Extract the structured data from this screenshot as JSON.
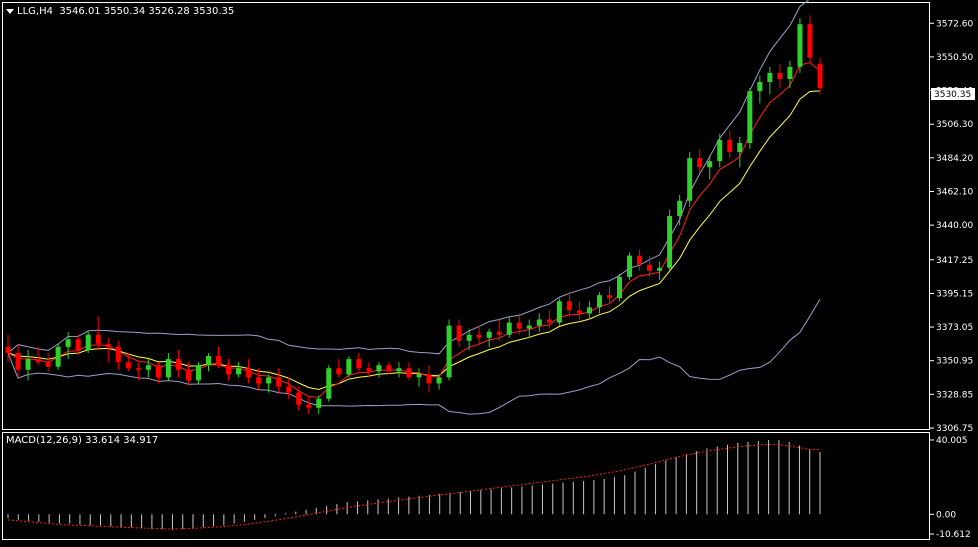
{
  "header": {
    "symbol_tf": "LLG,H4",
    "ohlc": "3546.01 3550.34 3526.28 3530.35"
  },
  "macd_header": "MACD(12,26,9) 33.614 34.917",
  "current_price": "3530.35",
  "colors": {
    "background": "#000000",
    "bull": "#2fd12f",
    "bear": "#ff0000",
    "ma_fast": "#ff2020",
    "ma_slow": "#ffff40",
    "bands": "#9aa0c8",
    "macd_hist": "#c8c8c8",
    "macd_signal": "#ff2020",
    "frame": "#ffffff"
  },
  "chart_data": [
    {
      "type": "candlestick",
      "title": "LLG,H4",
      "y_ticks": [
        "3572.60",
        "3550.50",
        "3528.40",
        "3506.30",
        "3484.20",
        "3462.10",
        "3440.00",
        "3417.25",
        "3395.15",
        "3373.05",
        "3350.95",
        "3328.85",
        "3306.75"
      ],
      "ylim": [
        3306.75,
        3580
      ],
      "candles": [
        [
          3360,
          3368,
          3350,
          3356
        ],
        [
          3356,
          3362,
          3340,
          3345
        ],
        [
          3345,
          3358,
          3338,
          3352
        ],
        [
          3352,
          3360,
          3348,
          3350
        ],
        [
          3350,
          3356,
          3344,
          3347
        ],
        [
          3347,
          3362,
          3345,
          3360
        ],
        [
          3360,
          3370,
          3352,
          3365
        ],
        [
          3365,
          3368,
          3355,
          3358
        ],
        [
          3358,
          3370,
          3356,
          3368
        ],
        [
          3368,
          3380,
          3358,
          3362
        ],
        [
          3362,
          3366,
          3350,
          3360
        ],
        [
          3360,
          3364,
          3345,
          3350
        ],
        [
          3350,
          3356,
          3344,
          3346
        ],
        [
          3346,
          3350,
          3338,
          3345
        ],
        [
          3345,
          3352,
          3340,
          3348
        ],
        [
          3348,
          3350,
          3336,
          3340
        ],
        [
          3340,
          3356,
          3338,
          3352
        ],
        [
          3352,
          3358,
          3340,
          3345
        ],
        [
          3345,
          3350,
          3335,
          3338
        ],
        [
          3338,
          3350,
          3336,
          3348
        ],
        [
          3348,
          3356,
          3344,
          3354
        ],
        [
          3354,
          3360,
          3346,
          3348
        ],
        [
          3348,
          3352,
          3338,
          3342
        ],
        [
          3342,
          3350,
          3340,
          3346
        ],
        [
          3346,
          3352,
          3336,
          3340
        ],
        [
          3340,
          3346,
          3332,
          3336
        ],
        [
          3336,
          3342,
          3330,
          3340
        ],
        [
          3340,
          3346,
          3330,
          3334
        ],
        [
          3334,
          3340,
          3326,
          3330
        ],
        [
          3330,
          3334,
          3318,
          3322
        ],
        [
          3322,
          3328,
          3316,
          3320
        ],
        [
          3320,
          3328,
          3316,
          3326
        ],
        [
          3326,
          3348,
          3324,
          3346
        ],
        [
          3346,
          3352,
          3340,
          3342
        ],
        [
          3342,
          3354,
          3340,
          3352
        ],
        [
          3352,
          3356,
          3344,
          3346
        ],
        [
          3346,
          3350,
          3340,
          3344
        ],
        [
          3344,
          3350,
          3340,
          3348
        ],
        [
          3348,
          3350,
          3342,
          3344
        ],
        [
          3344,
          3350,
          3340,
          3346
        ],
        [
          3346,
          3350,
          3338,
          3340
        ],
        [
          3340,
          3346,
          3334,
          3342
        ],
        [
          3342,
          3348,
          3330,
          3336
        ],
        [
          3336,
          3342,
          3332,
          3340
        ],
        [
          3340,
          3378,
          3338,
          3374
        ],
        [
          3374,
          3378,
          3360,
          3364
        ],
        [
          3364,
          3372,
          3358,
          3368
        ],
        [
          3368,
          3374,
          3362,
          3366
        ],
        [
          3366,
          3372,
          3360,
          3370
        ],
        [
          3370,
          3378,
          3364,
          3368
        ],
        [
          3368,
          3380,
          3366,
          3376
        ],
        [
          3376,
          3382,
          3368,
          3372
        ],
        [
          3372,
          3378,
          3366,
          3374
        ],
        [
          3374,
          3382,
          3370,
          3378
        ],
        [
          3378,
          3384,
          3372,
          3376
        ],
        [
          3376,
          3392,
          3374,
          3390
        ],
        [
          3390,
          3396,
          3380,
          3384
        ],
        [
          3384,
          3390,
          3378,
          3382
        ],
        [
          3382,
          3390,
          3378,
          3386
        ],
        [
          3386,
          3396,
          3382,
          3394
        ],
        [
          3394,
          3400,
          3388,
          3392
        ],
        [
          3392,
          3408,
          3390,
          3406
        ],
        [
          3406,
          3422,
          3404,
          3420
        ],
        [
          3420,
          3424,
          3410,
          3414
        ],
        [
          3414,
          3420,
          3406,
          3410
        ],
        [
          3410,
          3416,
          3404,
          3412
        ],
        [
          3412,
          3450,
          3410,
          3446
        ],
        [
          3446,
          3460,
          3440,
          3456
        ],
        [
          3456,
          3488,
          3452,
          3484
        ],
        [
          3484,
          3490,
          3474,
          3478
        ],
        [
          3478,
          3486,
          3470,
          3482
        ],
        [
          3482,
          3500,
          3478,
          3496
        ],
        [
          3496,
          3502,
          3484,
          3488
        ],
        [
          3488,
          3498,
          3478,
          3494
        ],
        [
          3494,
          3530,
          3490,
          3528
        ],
        [
          3528,
          3538,
          3520,
          3534
        ],
        [
          3534,
          3544,
          3526,
          3540
        ],
        [
          3540,
          3546,
          3530,
          3536
        ],
        [
          3536,
          3548,
          3530,
          3544
        ],
        [
          3544,
          3576,
          3540,
          3572
        ],
        [
          3572,
          3578,
          3546,
          3550
        ],
        [
          3546,
          3550,
          3526,
          3530
        ]
      ]
    },
    {
      "type": "bar",
      "title": "MACD(12,26,9) 33.614 34.917",
      "y_ticks": [
        "40.005",
        "0.00",
        "-10.612"
      ],
      "ylim": [
        -10.612,
        40.005
      ],
      "histogram": [
        -2,
        -3,
        -3.5,
        -4,
        -4.5,
        -5,
        -5,
        -5.5,
        -6,
        -6,
        -6.5,
        -7,
        -7,
        -7.5,
        -8,
        -8,
        -8.5,
        -8,
        -7.5,
        -7,
        -6.5,
        -6,
        -5,
        -4,
        -3,
        -2,
        -1,
        0.5,
        1.5,
        2.5,
        3.5,
        4.5,
        5.5,
        6.5,
        7,
        7.5,
        8,
        8.5,
        9,
        9.5,
        10,
        10.5,
        11,
        11.5,
        12,
        12.5,
        13,
        13.5,
        14,
        14.5,
        15,
        15.5,
        16,
        16.5,
        17,
        17.5,
        18,
        18.5,
        19,
        20,
        21,
        23,
        25,
        27,
        29,
        31,
        32.5,
        34,
        35.5,
        36.5,
        37.5,
        38.5,
        39,
        39.5,
        40,
        40,
        39,
        37,
        35,
        33.6
      ],
      "signal": [
        -3,
        -3.5,
        -4,
        -4.5,
        -5,
        -5.5,
        -5.8,
        -6,
        -6.2,
        -6.5,
        -6.8,
        -7,
        -7.2,
        -7.4,
        -7.6,
        -7.8,
        -7.9,
        -7.8,
        -7.6,
        -7.3,
        -7,
        -6.6,
        -6.1,
        -5.5,
        -4.8,
        -4,
        -3.2,
        -2.3,
        -1.4,
        -0.4,
        0.6,
        1.6,
        2.6,
        3.6,
        4.5,
        5.3,
        6.1,
        6.9,
        7.6,
        8.3,
        9,
        9.7,
        10.4,
        11.1,
        11.8,
        12.5,
        13.2,
        13.9,
        14.6,
        15.3,
        16,
        16.7,
        17.4,
        18.1,
        18.8,
        19.5,
        20.2,
        21,
        21.9,
        22.9,
        24,
        25.2,
        26.5,
        27.9,
        29.3,
        30.6,
        31.8,
        32.9,
        33.9,
        34.8,
        35.6,
        36.3,
        36.9,
        37.3,
        37.6,
        37.4,
        36.8,
        35.9,
        34.9,
        34.9
      ]
    }
  ]
}
